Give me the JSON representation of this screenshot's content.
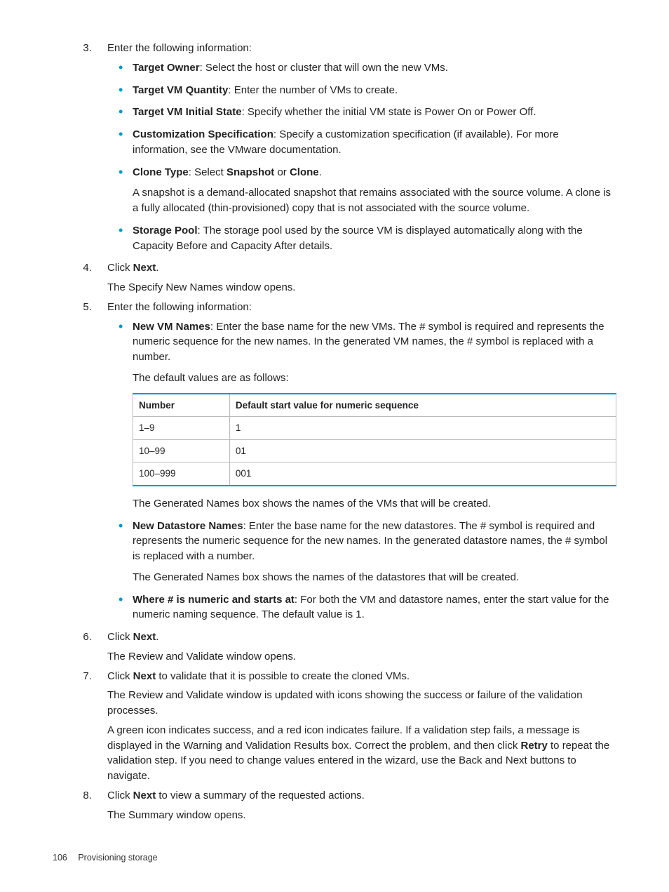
{
  "steps": {
    "s3": {
      "intro": "Enter the following information:",
      "items": {
        "targetOwner": {
          "label": "Target Owner",
          "text": ": Select the host or cluster that will own the new VMs."
        },
        "targetVMQty": {
          "label": "Target VM Quantity",
          "text": ": Enter the number of VMs to create."
        },
        "targetVMInit": {
          "label": "Target VM Initial State",
          "text": ": Specify whether the initial VM state is Power On or Power Off."
        },
        "custSpec": {
          "label": "Customization Specification",
          "text": ": Specify a customization specification (if available). For more information, see the VMware documentation."
        },
        "cloneType": {
          "label": "Clone Type",
          "pre": ": Select ",
          "opt1": "Snapshot",
          "mid": " or ",
          "opt2": "Clone",
          "post": ".",
          "para": "A snapshot is a demand-allocated snapshot that remains associated with the source volume. A clone is a fully allocated (thin-provisioned) copy that is not associated with the source volume."
        },
        "storagePool": {
          "label": "Storage Pool",
          "text": ": The storage pool used by the source VM is displayed automatically along with the Capacity Before and Capacity After details."
        }
      }
    },
    "s4": {
      "pre": "Click ",
      "bold": "Next",
      "post": ".",
      "para": "The Specify New Names window opens."
    },
    "s5": {
      "intro": "Enter the following information:",
      "items": {
        "newVMNames": {
          "label": "New VM Names",
          "text": ": Enter the base name for the new VMs. The # symbol is required and represents the numeric sequence for the new names. In the generated VM names, the # symbol is replaced with a number.",
          "defaultsIntro": "The default values are as follows:",
          "afterTable": "The Generated Names box shows the names of the VMs that will be created."
        },
        "newDSNames": {
          "label": "New Datastore Names",
          "text": ": Enter the base name for the new datastores. The # symbol is required and represents the numeric sequence for the new names. In the generated datastore names, the # symbol is replaced with a number.",
          "after": "The Generated Names box shows the names of the datastores that will be created."
        },
        "whereNum": {
          "label": "Where # is numeric and starts at",
          "text": ": For both the VM and datastore names, enter the start value for the numeric naming sequence. The default value is 1."
        }
      }
    },
    "s6": {
      "pre": "Click ",
      "bold": "Next",
      "post": ".",
      "para": "The Review and Validate window opens."
    },
    "s7": {
      "pre": "Click ",
      "bold": "Next",
      "post": " to validate that it is possible to create the cloned VMs.",
      "para1": "The Review and Validate window is updated with icons showing the success or failure of the validation processes.",
      "para2a": "A green icon indicates success, and a red icon indicates failure. If a validation step fails, a message is displayed in the Warning and Validation Results box. Correct the problem, and then click ",
      "retry": "Retry",
      "para2b": " to repeat the validation step. If you need to change values entered in the wizard, use the Back and Next buttons to navigate."
    },
    "s8": {
      "pre": "Click ",
      "bold": "Next",
      "post": " to view a summary of the requested actions.",
      "para": "The Summary window opens."
    }
  },
  "table": {
    "h1": "Number",
    "h2": "Default start value for numeric sequence",
    "rows": [
      {
        "c1": "1–9",
        "c2": "1"
      },
      {
        "c1": "10–99",
        "c2": "01"
      },
      {
        "c1": "100–999",
        "c2": "001"
      }
    ]
  },
  "footer": {
    "page": "106",
    "section": "Provisioning storage"
  }
}
